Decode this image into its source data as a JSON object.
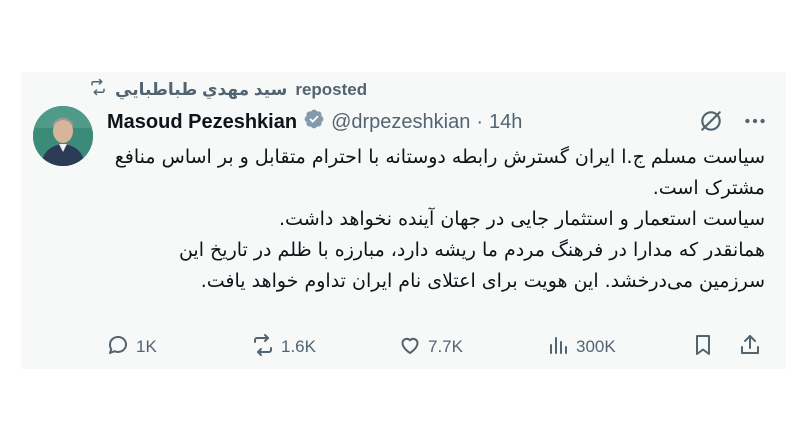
{
  "repost": {
    "reposter": "سيد مهدي طباطبايي",
    "label": "reposted"
  },
  "author": {
    "name": "Masoud Pezeshkian",
    "handle": "@drpezeshkian",
    "separator": "·",
    "time": "14h",
    "verified": true
  },
  "tweet": {
    "lines": [
      "سیاست مسلم ج.ا ایران گسترش رابطه دوستانه با احترام متقابل و بر اساس منافع مشترک است.",
      "سیاست استعمار و استثمار جایی در جهان آینده نخواهد داشت.",
      "همانقدر که مدارا در فرهنگ مردم ما ریشه دارد، مبارزه با ظلم در تاریخ این سرزمین می‌درخشد. این هویت برای اعتلای نام ایران تداوم خواهد یافت."
    ]
  },
  "stats": {
    "replies": "1K",
    "reposts": "1.6K",
    "likes": "7.7K",
    "views": "300K"
  },
  "icons": {
    "repost_header": "repost-icon",
    "verified": "verified-badge-icon",
    "grok": "grok-icon",
    "more": "more-icon",
    "reply": "reply-icon",
    "repost": "repost-icon",
    "like": "heart-icon",
    "views": "views-icon",
    "bookmark": "bookmark-icon",
    "share": "share-icon"
  },
  "colors": {
    "card_bg": "#f7f9f9",
    "muted": "#536471",
    "text": "#0f1419",
    "verified": "#829aab"
  }
}
